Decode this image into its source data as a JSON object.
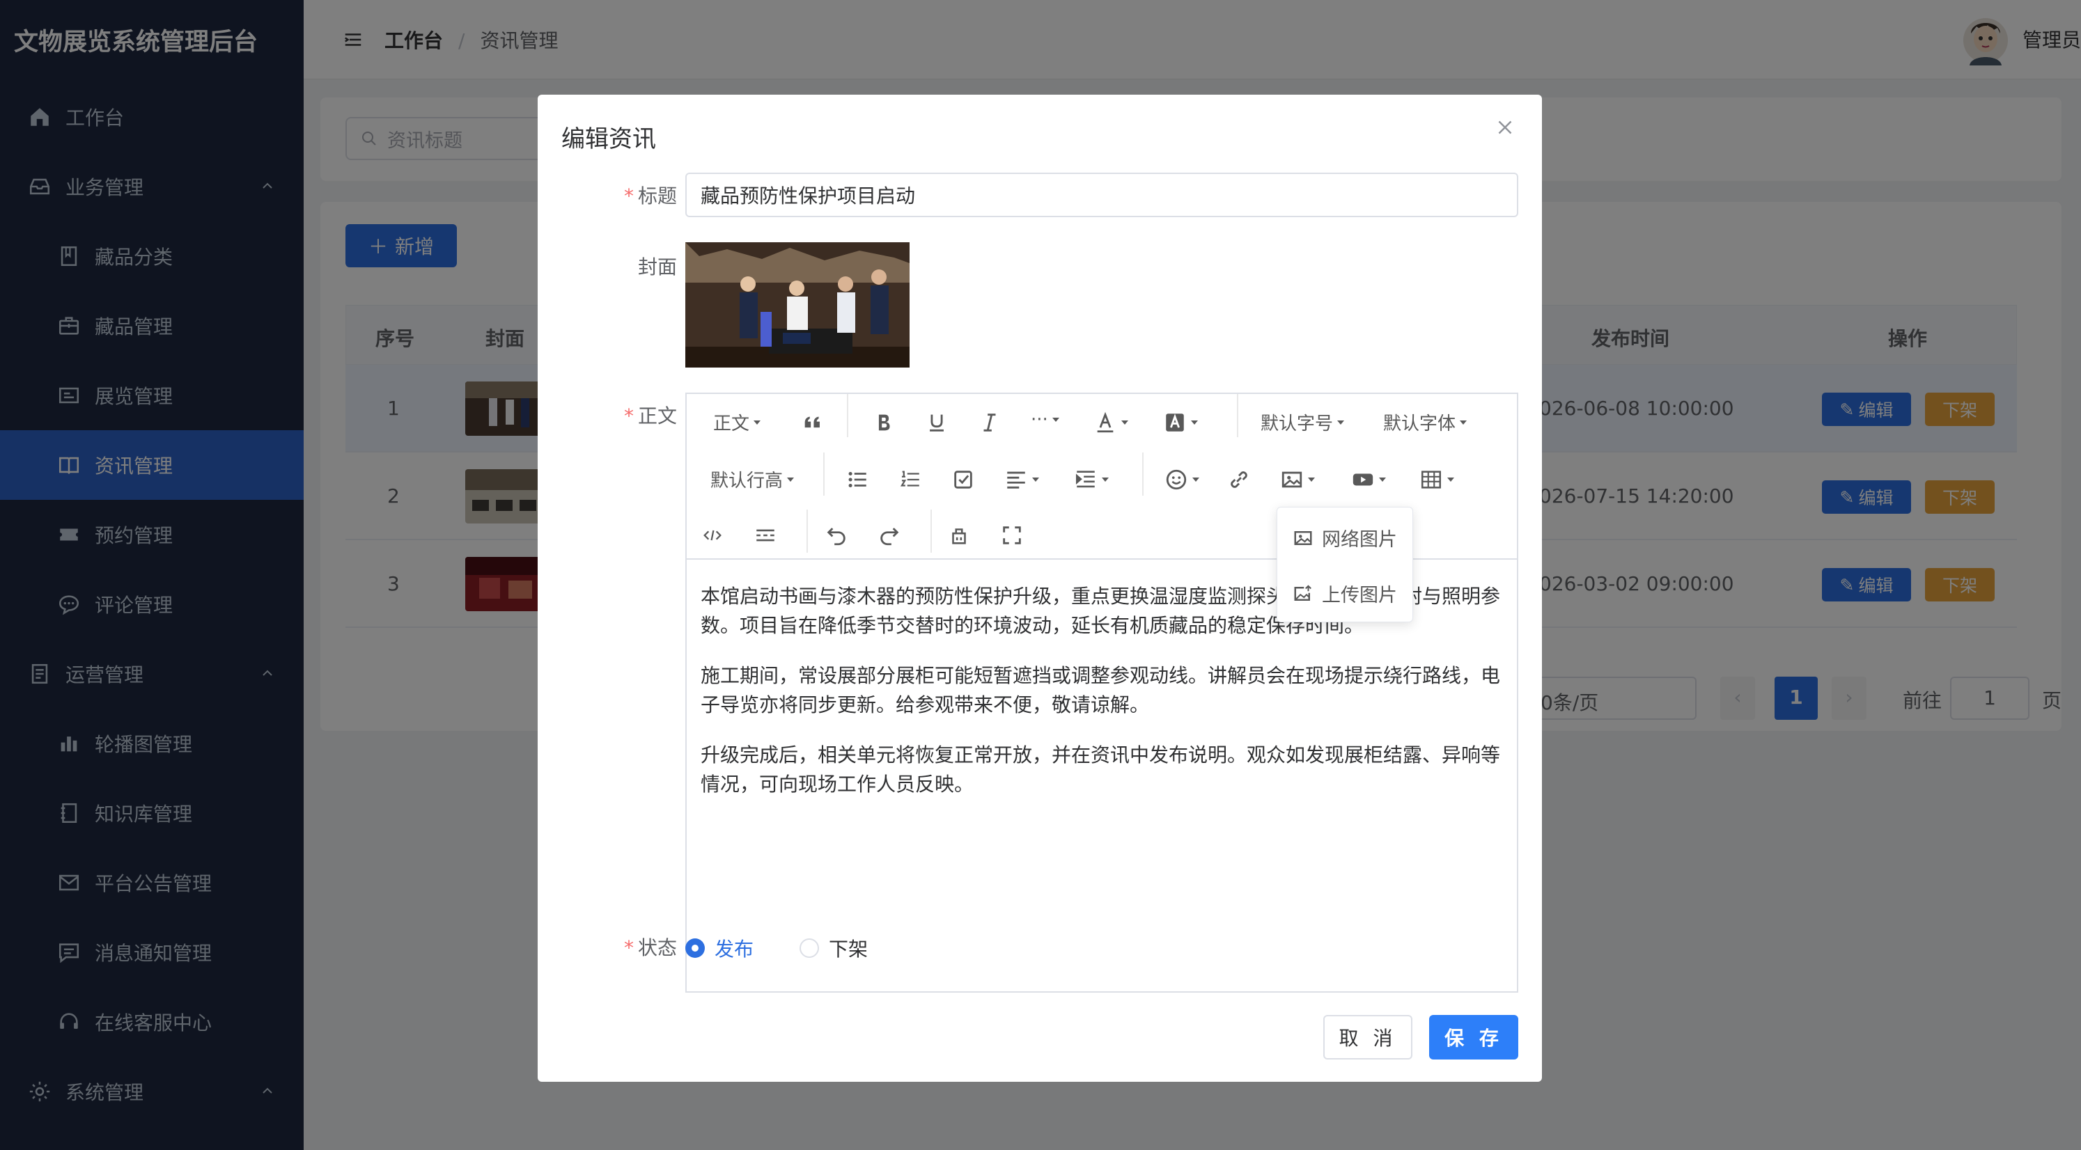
{
  "app": {
    "title": "文物展览系统管理后台"
  },
  "sidebar": {
    "items": [
      {
        "label": "工作台",
        "icon": "home-icon"
      },
      {
        "label": "业务管理",
        "icon": "inbox-icon"
      },
      {
        "label": "藏品分类",
        "icon": "book-icon"
      },
      {
        "label": "藏品管理",
        "icon": "briefcase-icon"
      },
      {
        "label": "展览管理",
        "icon": "id-card-icon"
      },
      {
        "label": "资讯管理",
        "icon": "reading-icon"
      },
      {
        "label": "预约管理",
        "icon": "ticket-icon"
      },
      {
        "label": "评论管理",
        "icon": "chat-icon"
      },
      {
        "label": "运营管理",
        "icon": "document-icon"
      },
      {
        "label": "轮播图管理",
        "icon": "bar-chart-icon"
      },
      {
        "label": "知识库管理",
        "icon": "notebook-icon"
      },
      {
        "label": "平台公告管理",
        "icon": "message-icon"
      },
      {
        "label": "消息通知管理",
        "icon": "chat-square-icon"
      },
      {
        "label": "在线客服中心",
        "icon": "headset-icon"
      },
      {
        "label": "系统管理",
        "icon": "gear-icon"
      }
    ]
  },
  "header": {
    "breadcrumb_root": "工作台",
    "breadcrumb_sep": "/",
    "breadcrumb_current": "资讯管理",
    "user_name": "管理员"
  },
  "page": {
    "search_placeholder": "资讯标题",
    "add_label": "新增",
    "columns": {
      "index": "序号",
      "cover": "封面",
      "publish_time": "发布时间",
      "actions": "操作"
    },
    "rows": [
      {
        "index": "1",
        "time": "026-06-08 10:00:00",
        "edit": "编辑",
        "off": "下架"
      },
      {
        "index": "2",
        "time": "026-07-15 14:20:00",
        "edit": "编辑",
        "off": "下架"
      },
      {
        "index": "3",
        "time": "026-03-02 09:00:00",
        "edit": "编辑",
        "off": "下架"
      }
    ],
    "pager": {
      "page_size": "0条/页",
      "current": "1",
      "goto_label": "前往",
      "goto_value": "1",
      "page_suffix": "页"
    }
  },
  "dialog": {
    "title": "编辑资讯",
    "title_label": "标题",
    "title_value": "藏品预防性保护项目启动",
    "cover_label": "封面",
    "body_label": "正文",
    "toolbar": {
      "paragraph": "正文",
      "font_size": "默认字号",
      "font_family": "默认字体",
      "line_height": "默认行高",
      "more": "···"
    },
    "image_menu": [
      "网络图片",
      "上传图片"
    ],
    "paragraphs": [
      "本馆启动书画与漆木器的预防性保护升级，重点更换温湿度监测探头、调整展柜密封与照明参数。项目旨在降低季节交替时的环境波动，延长有机质藏品的稳定保存时间。",
      "施工期间，常设展部分展柜可能短暂遮挡或调整参观动线。讲解员会在现场提示绕行路线，电子导览亦将同步更新。给参观带来不便，敬请谅解。",
      "升级完成后，相关单元将恢复正常开放，并在资讯中发布说明。观众如发现展柜结露、异响等情况，可向现场工作人员反映。"
    ],
    "status_label": "状态",
    "status_options": [
      "发布",
      "下架"
    ],
    "status_selected": "发布",
    "cancel_label": "取 消",
    "save_label": "保 存"
  },
  "colors": {
    "primary": "#2d6fe0",
    "warning": "#e6a23c",
    "sidebar_bg": "#1f2940",
    "danger": "#f56c6c"
  }
}
